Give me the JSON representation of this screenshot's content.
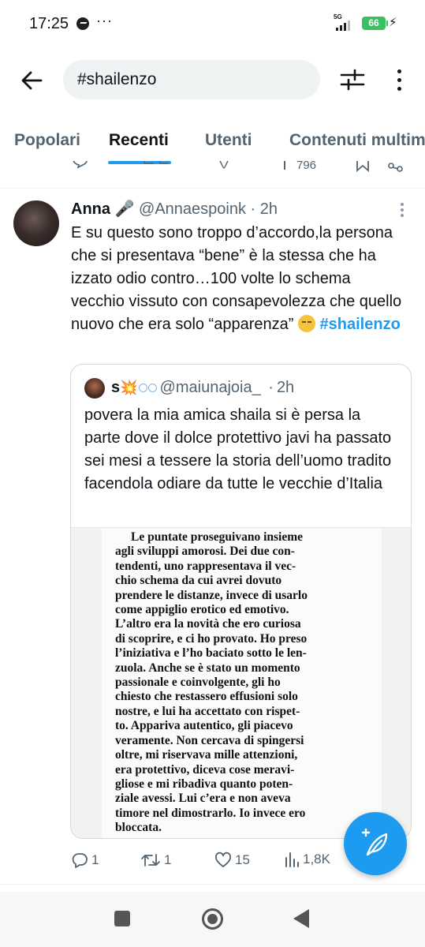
{
  "status_bar": {
    "time": "17:25",
    "more": "···",
    "network": "5G",
    "battery": "66"
  },
  "search": {
    "query": "#shailenzo"
  },
  "tabs": [
    {
      "label": "Popolari"
    },
    {
      "label": "Recenti"
    },
    {
      "label": "Utenti"
    },
    {
      "label": "Contenuti multimediali"
    }
  ],
  "prev_tweet": {
    "views": "796"
  },
  "tweet": {
    "author_name": "Anna",
    "author_emoji": "🎤",
    "author_handle": "@Annaespoink",
    "time": "2h",
    "text_before_hashtag": "E su questo sono troppo d’accordo,la persona che si presentava “bene” è la stessa che ha izzato odio contro…100 volte lo schema vecchio vissuto con consapevolezza che quello nuovo che era solo “apparenza” ",
    "hashtag": "#shailenzo",
    "quote": {
      "name": "s",
      "name_emojis": "💥",
      "handle": "@maiunajoia_",
      "time": "2h",
      "text": "povera la mia amica shaila si è persa la parte dove il dolce protettivo javi ha passato sei mesi a tessere la storia dell’uomo tradito facendola odiare da tutte le vecchie d’Italia",
      "book_lines": [
        "Le puntate proseguivano insieme",
        "agli sviluppi amorosi. Dei due con-",
        "tendenti, uno rappresentava il vec-",
        "chio schema da cui avrei dovuto",
        "prendere le distanze, invece di usarlo",
        "come appiglio erotico ed emotivo.",
        "L’altro era la novità che ero curiosa",
        "di scoprire, e ci ho provato. Ho preso",
        "l’iniziativa e l’ho baciato sotto le len-",
        "zuola. Anche se è stato un momento",
        "passionale e coinvolgente, gli ho",
        "chiesto che restassero effusioni solo",
        "nostre, e lui ha accettato con rispet-",
        "to. Appariva autentico, gli piacevo",
        "veramente. Non cercava di spingersi",
        "oltre, mi riservava mille attenzioni,",
        "era protettivo, diceva cose meravi-",
        "gliose e mi ribadiva quanto poten-",
        "ziale avessi. Lui c’era e non aveva",
        "timore nel dimostrarlo. Io invece ero",
        "bloccata."
      ]
    },
    "stats": {
      "replies": "1",
      "retweets": "1",
      "likes": "15",
      "views": "1,8K"
    }
  },
  "colors": {
    "accent": "#1d9bf0",
    "secondary_text": "#536471",
    "primary_text": "#0f1419",
    "battery": "#3ac060"
  },
  "icons": {
    "back": "arrow-left-icon",
    "filter": "sliders-icon",
    "more": "vertical-ellipsis-icon",
    "reply": "speech-bubble-icon",
    "retweet": "retweet-icon",
    "like": "heart-icon",
    "views": "bar-chart-icon",
    "compose": "feather-plus-icon"
  }
}
